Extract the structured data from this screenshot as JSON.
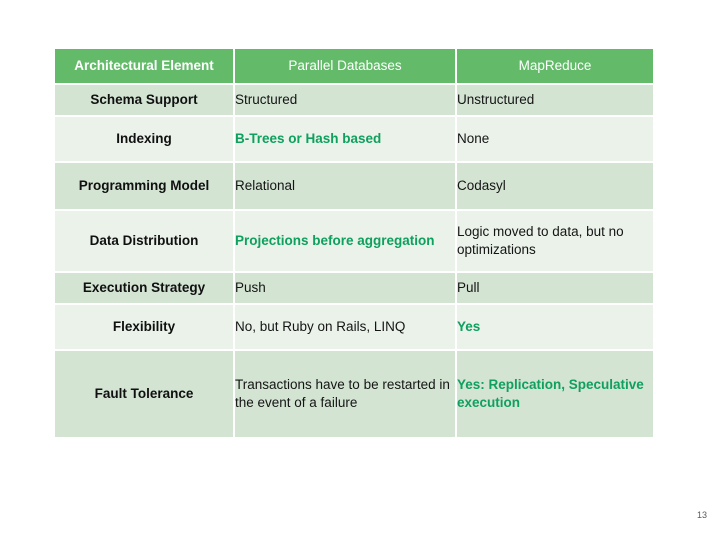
{
  "slide": {
    "page_number": "13"
  },
  "colors": {
    "header_green": "#63bb6a",
    "band_dark": "#d3e4d3",
    "band_light": "#eaf2ea",
    "accent_green": "#0fa05e",
    "header_text": "#ffffff",
    "body_text": "#151515"
  },
  "table": {
    "headers": [
      "Architectural Element",
      "Parallel Databases",
      "MapReduce"
    ],
    "rows": [
      {
        "label": "Schema Support",
        "parallel_databases": "Structured",
        "mapreduce": "Unstructured",
        "parallel_accent": false,
        "mapreduce_accent": false
      },
      {
        "label": "Indexing",
        "parallel_databases": "B-Trees or Hash based",
        "mapreduce": "None",
        "parallel_accent": true,
        "mapreduce_accent": false
      },
      {
        "label": "Programming Model",
        "parallel_databases": "Relational",
        "mapreduce": "Codasyl",
        "parallel_accent": false,
        "mapreduce_accent": false
      },
      {
        "label": "Data Distribution",
        "parallel_databases": "Projections before aggregation",
        "mapreduce": "Logic moved to data, but no optimizations",
        "parallel_accent": true,
        "mapreduce_accent": false
      },
      {
        "label": "Execution Strategy",
        "parallel_databases": "Push",
        "mapreduce": "Pull",
        "parallel_accent": false,
        "mapreduce_accent": false
      },
      {
        "label": "Flexibility",
        "parallel_databases": "No, but Ruby on Rails, LINQ",
        "mapreduce": "Yes",
        "parallel_accent": false,
        "mapreduce_accent": true
      },
      {
        "label": "Fault Tolerance",
        "parallel_databases": "Transactions have to be restarted in the event of a failure",
        "mapreduce": "Yes: Replication, Speculative execution",
        "parallel_accent": false,
        "mapreduce_accent": true
      }
    ]
  }
}
